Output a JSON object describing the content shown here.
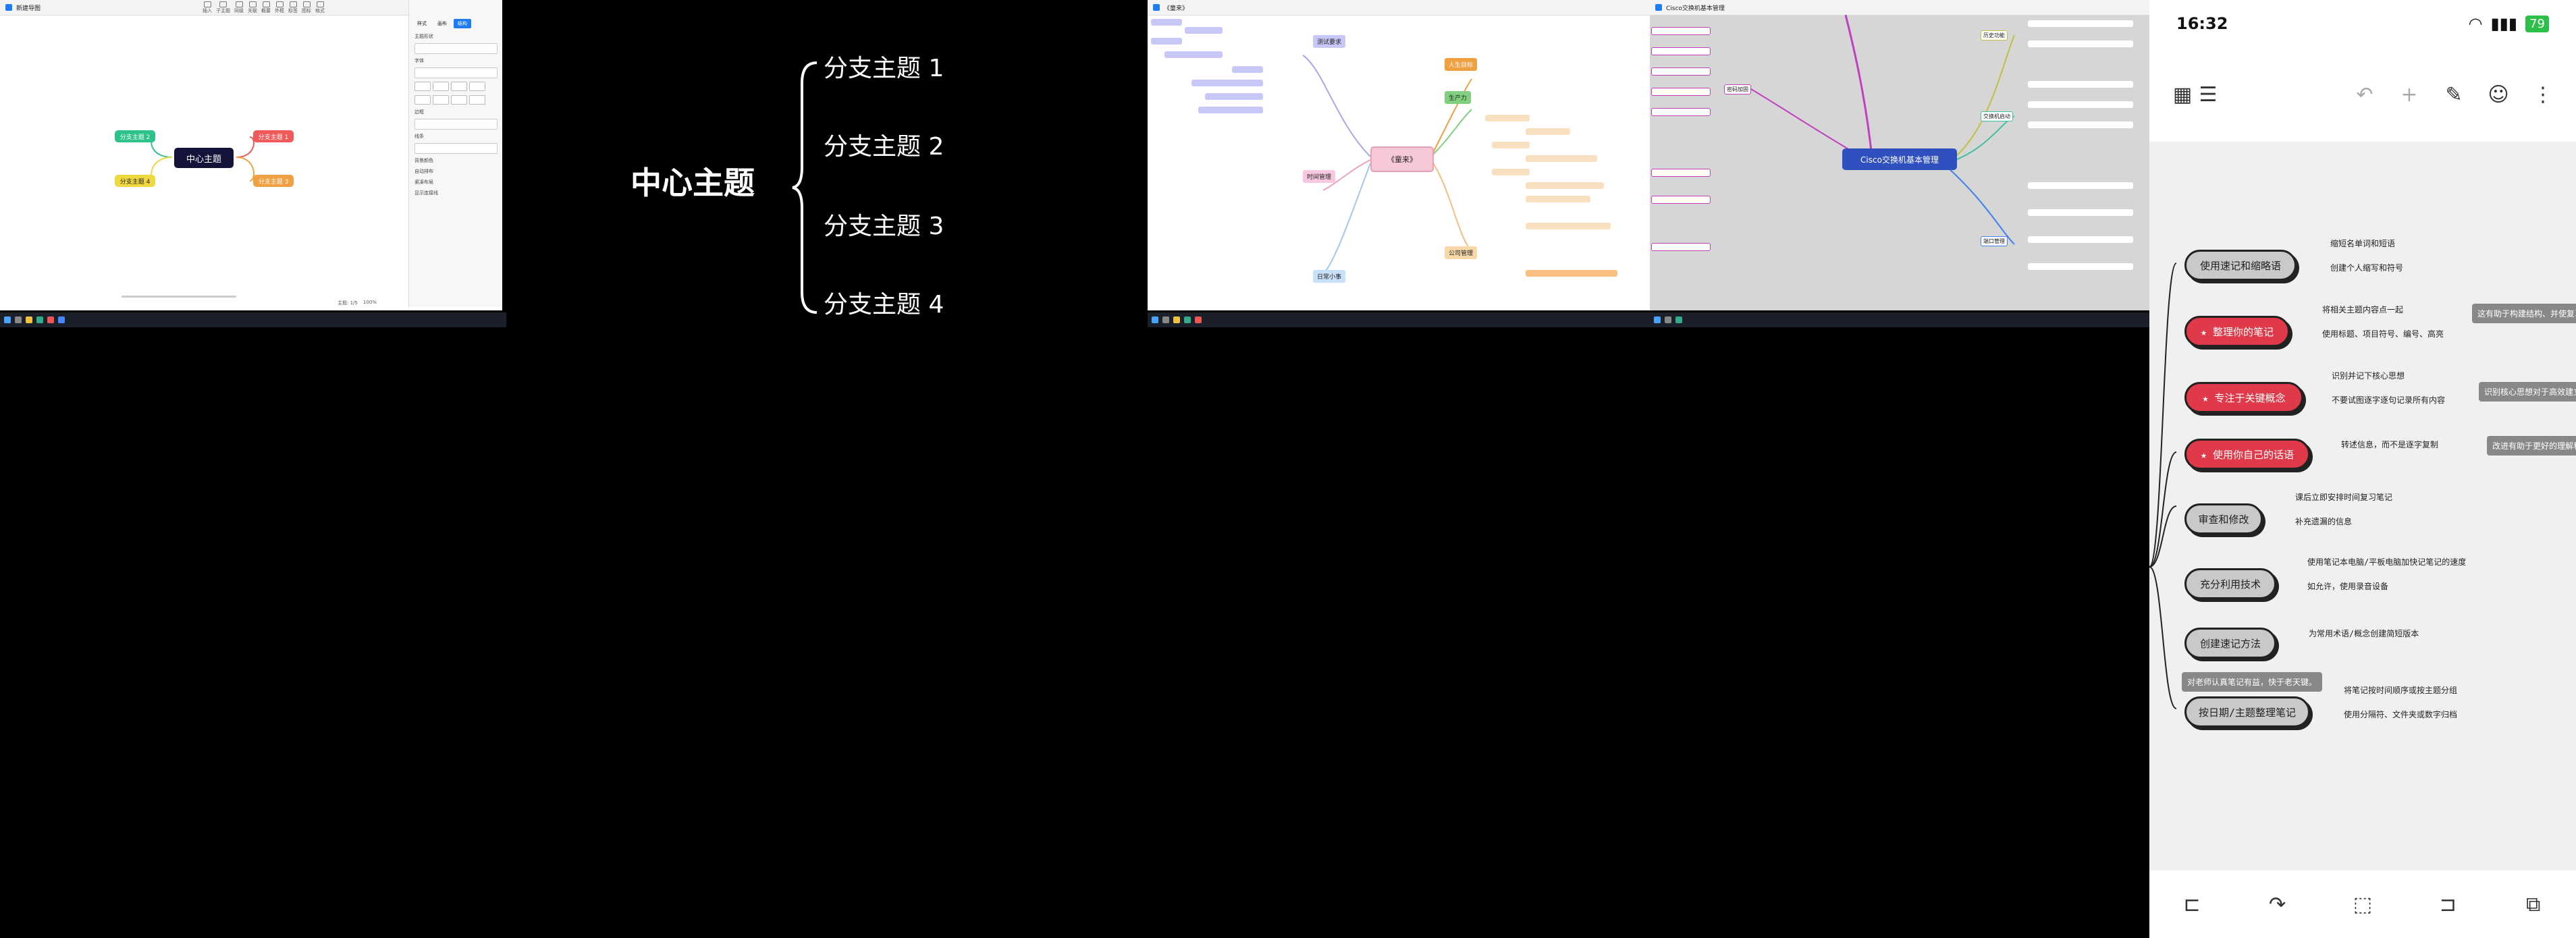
{
  "panel1": {
    "window_title": "新建导图",
    "toolbar": [
      "插入",
      "子主题",
      "同级",
      "关联",
      "概要",
      "外框",
      "标签",
      "图标",
      "格式"
    ],
    "side_tabs": [
      "样式",
      "画布",
      "结构"
    ],
    "side_rows": [
      "主题形状",
      "字体",
      "边框",
      "线条",
      "背景颜色",
      "自动排布",
      "紧凑布局",
      "显示连接线"
    ],
    "center": "中心主题",
    "branches": [
      "分支主题 1",
      "分支主题 2",
      "分支主题 3",
      "分支主题 4"
    ],
    "status": "主题: 1/5",
    "zoom": "100%",
    "colors": {
      "center": "#14143a",
      "b1": "#f05a5a",
      "b2": "#2cc28a",
      "b3": "#f0a040",
      "b4": "#f0d840"
    }
  },
  "panel2": {
    "center": "中心主题",
    "branches": [
      "分支主题 1",
      "分支主题 2",
      "分支主题 3",
      "分支主题 4"
    ]
  },
  "panel3": {
    "window_title": "《童来》",
    "center": "《童来》",
    "branches": [
      "测试要求",
      "时间管理",
      "日常小事",
      "人生目标",
      "生产力",
      "公司管理"
    ]
  },
  "panel4": {
    "window_title": "Cisco交换机基本管理",
    "center": "Cisco交换机基本管理",
    "branches": [
      "密码加固",
      "交换机启动",
      "历史功能",
      "端口管理"
    ]
  },
  "phone": {
    "time": "16:32",
    "battery": "79",
    "nodes": [
      {
        "label": "使用速记和缩略语",
        "color": "#c9c9c9",
        "leaves": [
          "缩短名单词和短语",
          "创建个人缩写和符号"
        ]
      },
      {
        "label": "★ 整理你的笔记",
        "color": "#e03a4a",
        "leaves": [
          "将相关主题内容点一起",
          "使用标题、项目符号、编号、高亮"
        ],
        "note": "这有助于构建结构、并使复习更加容易，记。"
      },
      {
        "label": "★ 专注于关键概念",
        "color": "#e03a4a",
        "leaves": [
          "识别并记下核心思想",
          "不要试图逐字逐句记录所有内容"
        ],
        "note": "识别核心思想对于高效建立知识"
      },
      {
        "label": "★ 使用你自己的话语",
        "color": "#e03a4a",
        "leaves": [
          "转述信息，而不是逐字复制"
        ],
        "note": "改进有助于更好的理解和记忆"
      },
      {
        "label": "审查和修改",
        "color": "#c9c9c9",
        "leaves": [
          "课后立即安排时间复习笔记",
          "补充遗漏的信息"
        ]
      },
      {
        "label": "充分利用技术",
        "color": "#c9c9c9",
        "leaves": [
          "使用笔记本电脑/平板电脑加快记笔记的速度",
          "如允许，使用录音设备"
        ]
      },
      {
        "label": "创建速记方法",
        "color": "#c9c9c9",
        "leaves": [
          "为常用术语/概念创建简短版本"
        ]
      },
      {
        "label": "按日期/主题整理笔记",
        "color": "#c9c9c9",
        "leaves": [
          "将笔记按时间顺序或按主题分组",
          "使用分隔符、文件夹或数字归档"
        ],
        "note": "对老师认真笔记有益，快于老天键。"
      }
    ]
  }
}
